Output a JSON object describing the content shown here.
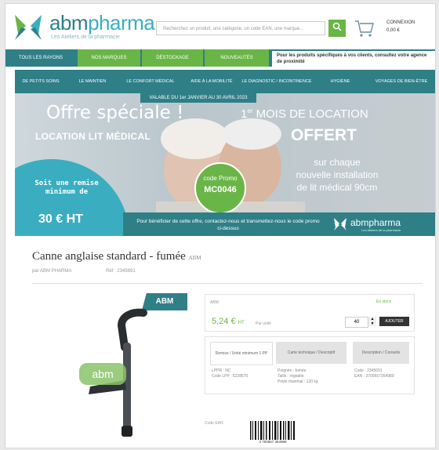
{
  "header": {
    "brand": [
      "abm",
      "pharma"
    ],
    "tagline": "Les Ateliers de la pharmacie",
    "search_placeholder": "Recherchez un produit, une catégorie, un code EAN, une marque...",
    "account_line1": "CONNEXION",
    "account_line2": "0,00 €"
  },
  "nav": {
    "items": [
      {
        "label": "TOUS LES RAYONS",
        "green": false
      },
      {
        "label": "NOS MARQUES",
        "green": true
      },
      {
        "label": "DÉSTOCKAGE",
        "green": true
      },
      {
        "label": "NOUVEAUTÉS",
        "green": true
      }
    ],
    "promo_text": "Pour les produits spécifiques à vos clients, consultez votre agence de proximité"
  },
  "subnav": {
    "items": [
      "DE PETITS SOINS",
      "LE MAINTIEN",
      "LE CONFORT MÉDICAL",
      "AIDE À LA MOBILITÉ",
      "LE DIAGNOSTIC / INCONTINENCE",
      "HYGIÈNE",
      "VOYAGES DE BIEN-ÊTRE"
    ]
  },
  "banner": {
    "validity": "VALABLE DU 1er JANVIER AU 30 AVRIL 2023",
    "headline": "Offre spéciale !",
    "subheadline": "LOCATION LIT MÉDICAL",
    "mois": "MOIS DE LOCATION",
    "mois_num": "1",
    "mois_sup": "er",
    "offert": "OFFERT",
    "details_line1": "sur chaque",
    "details_line2": "nouvelle installation",
    "details_line3": "de lit médical 90cm",
    "promo_label": "code Promo",
    "promo_code": "MC0046",
    "remise_text": "Soit une remise minimum de",
    "remise_value": "30 € HT",
    "footer_text": "Pour bénéficier de cette offre, contactez-nous et transmettez-nous le code promo ci-dessus",
    "footer_brand": "abmpharma",
    "footer_tagline": "Les Ateliers de la pharmacie"
  },
  "product": {
    "title": "Canne anglaise standard - fumée",
    "title_suffix": "ABM",
    "brand_line": "par ABM PHARMA",
    "ref_line": "Réf : 2345691",
    "badge": "ABM",
    "card_header": "ABM",
    "stock": "En stock",
    "price": "5,24 €",
    "price_suffix": "HT",
    "price_unit": "Par unité",
    "quantity": "40",
    "add_to_cart": "AJOUTER",
    "tabs": [
      {
        "label": "Remise / Unité minimum 1 PP"
      },
      {
        "label": "Carte technique / Descriptif"
      },
      {
        "label": "Description / Conseils"
      }
    ],
    "details_col1": "LPPR : NC\nCode LPP : 6228670",
    "details_col2": "Poignée : fumée\nTaille : réglable\nPoids maximal : 120 kg",
    "details_col3": "Code : 2345691\nEAN : 3700657354989",
    "ean_label": "Code EAN",
    "ean_number": "3 700657 354989"
  },
  "colors": {
    "teal": "#2f7f87",
    "green": "#6ab547",
    "light_blue": "#3aaec0"
  }
}
